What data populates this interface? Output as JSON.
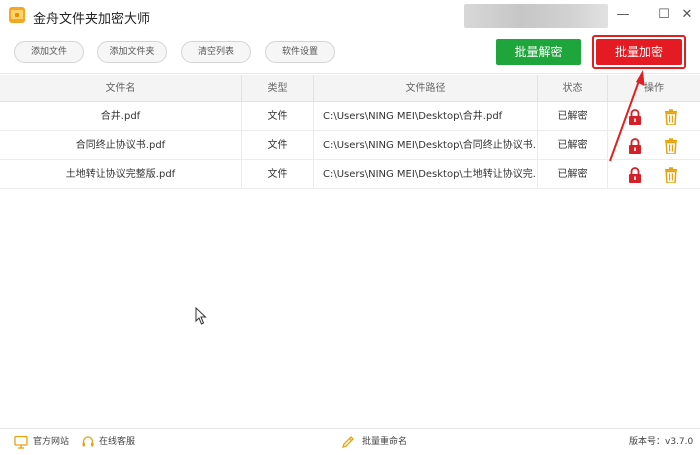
{
  "window": {
    "title": "金舟文件夹加密大师",
    "minimize": "—",
    "maximize": "☐",
    "close": "✕"
  },
  "toolbar": {
    "add_file": "添加文件",
    "add_folder": "添加文件夹",
    "clear_list": "清空列表",
    "settings": "软件设置",
    "batch_decrypt": "批量解密",
    "batch_encrypt": "批量加密"
  },
  "table": {
    "headers": [
      "文件名",
      "类型",
      "文件路径",
      "状态",
      "操作"
    ],
    "rows": [
      {
        "name": "合井.pdf",
        "type": "文件",
        "path": "C:\\Users\\NING MEI\\Desktop\\合井.pdf",
        "status": "已解密"
      },
      {
        "name": "合同终止协议书.pdf",
        "type": "文件",
        "path": "C:\\Users\\NING MEI\\Desktop\\合同终止协议书...",
        "status": "已解密"
      },
      {
        "name": "土地转让协议完整版.pdf",
        "type": "文件",
        "path": "C:\\Users\\NING MEI\\Desktop\\土地转让协议完...",
        "status": "已解密"
      }
    ]
  },
  "statusbar": {
    "website": "官方网站",
    "support": "在线客服",
    "rename": "批量重命名",
    "version": "版本号：v3.7.0"
  },
  "colors": {
    "decrypt_green": "#1ea53c",
    "encrypt_red": "#e41b23",
    "lock_red": "#d61f26",
    "trash_orange": "#e8a20c"
  },
  "icons": {
    "app": "folder-lock-icon",
    "row_lock": "lock-icon",
    "row_delete": "trash-icon",
    "website": "monitor-icon",
    "support": "headset-icon",
    "rename": "rename-icon"
  }
}
